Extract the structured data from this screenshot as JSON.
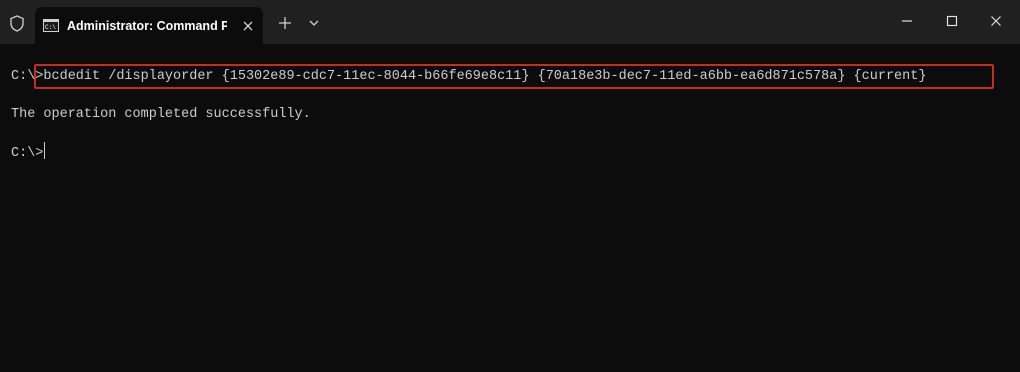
{
  "window": {
    "tab_title": "Administrator: Command Pro",
    "icons": {
      "shield": "shield-icon",
      "tab": "command-prompt-icon",
      "close_tab": "close-icon",
      "new_tab": "plus-icon",
      "dropdown": "chevron-down-icon",
      "minimize": "minimize-icon",
      "maximize": "maximize-icon",
      "close": "close-icon"
    },
    "accent_highlight": "#c42b2b"
  },
  "terminal": {
    "prompt1": "C:\\>",
    "command": "bcdedit /displayorder {15302e89-cdc7-11ec-8044-b66fe69e8c11} {70a18e3b-dec7-11ed-a6bb-ea6d871c578a} {current}",
    "output": "The operation completed successfully.",
    "prompt2": "C:\\>"
  }
}
